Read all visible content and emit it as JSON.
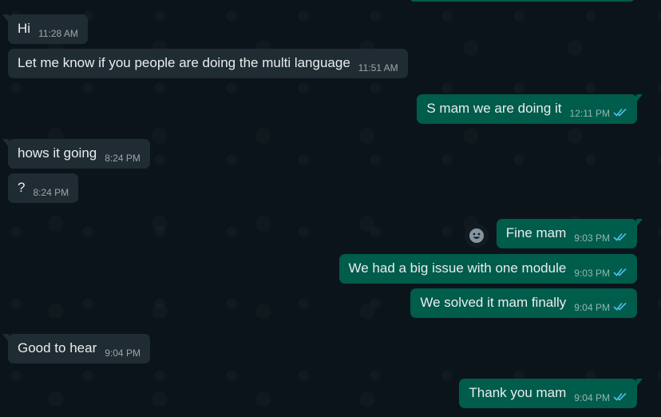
{
  "messages": [
    {
      "direction": "in",
      "text": "Hi",
      "time": "11:28 AM"
    },
    {
      "direction": "in",
      "text": "Let me know if you people are doing the multi language",
      "time": "11:51 AM"
    },
    {
      "direction": "out",
      "text": "S mam we are doing it",
      "time": "12:11 PM",
      "status": "read"
    },
    {
      "direction": "in",
      "text": "hows it going",
      "time": "8:24 PM"
    },
    {
      "direction": "in",
      "text": "?",
      "time": "8:24 PM"
    },
    {
      "direction": "out",
      "text": "Fine mam",
      "time": "9:03 PM",
      "status": "read"
    },
    {
      "direction": "out",
      "text": "We had a big issue with one module",
      "time": "9:03 PM",
      "status": "read"
    },
    {
      "direction": "out",
      "text": "We solved it mam finally",
      "time": "9:04 PM",
      "status": "read"
    },
    {
      "direction": "in",
      "text": "Good to hear",
      "time": "9:04 PM"
    },
    {
      "direction": "out",
      "text": "Thank you mam",
      "time": "9:04 PM",
      "status": "read"
    }
  ],
  "icons": {
    "read_receipt": "double-check-icon",
    "emoji": "emoji-reaction-icon"
  },
  "colors": {
    "background": "#0b141a",
    "incoming_bubble": "#202c33",
    "outgoing_bubble": "#005c4b",
    "read_tick": "#53bdeb"
  }
}
